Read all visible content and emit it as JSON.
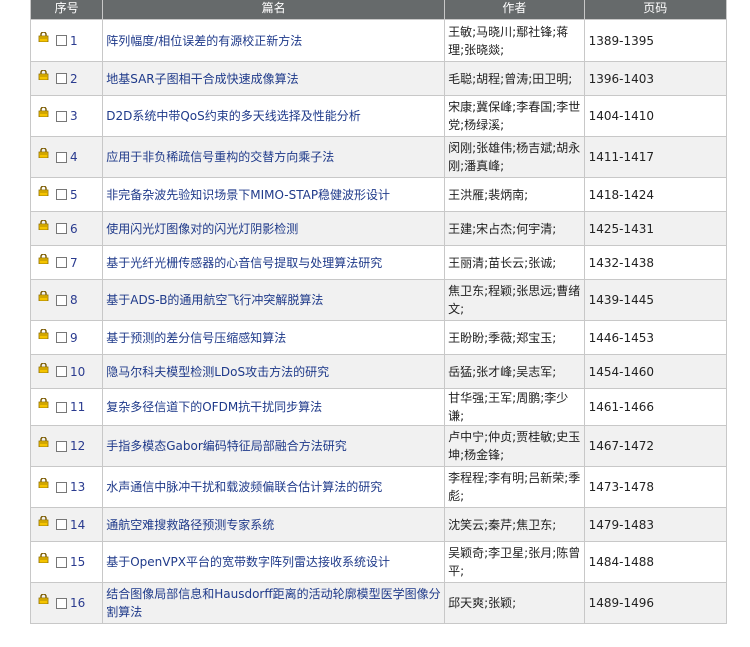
{
  "headers": {
    "seq": "序号",
    "title": "篇名",
    "author": "作者",
    "pages": "页码"
  },
  "rows": [
    {
      "num": "1",
      "title": "阵列幅度/相位误差的有源校正新方法",
      "authors": "王敏;马晓川;鄢社锋;蒋理;张晓燚;",
      "pages": "1389-1395"
    },
    {
      "num": "2",
      "title": "地基SAR子图相干合成快速成像算法",
      "authors": "毛聪;胡程;曾涛;田卫明;",
      "pages": "1396-1403"
    },
    {
      "num": "3",
      "title": "D2D系统中带QoS约束的多天线选择及性能分析",
      "authors": "宋康;冀保峰;李春国;李世党;杨绿溪;",
      "pages": "1404-1410"
    },
    {
      "num": "4",
      "title": "应用于非负稀疏信号重构的交替方向乘子法",
      "authors": "闵刚;张雄伟;杨吉斌;胡永刚;潘真峰;",
      "pages": "1411-1417"
    },
    {
      "num": "5",
      "title": "非完备杂波先验知识场景下MIMO-STAP稳健波形设计",
      "authors": "王洪雁;裴炳南;",
      "pages": "1418-1424"
    },
    {
      "num": "6",
      "title": "使用闪光灯图像对的闪光灯阴影检测",
      "authors": "王建;宋占杰;何宇清;",
      "pages": "1425-1431"
    },
    {
      "num": "7",
      "title": "基于光纤光栅传感器的心音信号提取与处理算法研究",
      "authors": "王丽清;苗长云;张诚;",
      "pages": "1432-1438"
    },
    {
      "num": "8",
      "title": "基于ADS-B的通用航空飞行冲突解脱算法",
      "authors": "焦卫东;程颖;张思远;曹绪文;",
      "pages": "1439-1445"
    },
    {
      "num": "9",
      "title": "基于预测的差分信号压缩感知算法",
      "authors": "王盼盼;季薇;郑宝玉;",
      "pages": "1446-1453"
    },
    {
      "num": "10",
      "title": "隐马尔科夫模型检测LDoS攻击方法的研究",
      "authors": "岳猛;张才峰;吴志军;",
      "pages": "1454-1460"
    },
    {
      "num": "11",
      "title": "复杂多径信道下的OFDM抗干扰同步算法",
      "authors": "甘华强;王军;周鹏;李少谦;",
      "pages": "1461-1466"
    },
    {
      "num": "12",
      "title": "手指多模态Gabor编码特征局部融合方法研究",
      "authors": "卢中宁;仲贞;贾桂敏;史玉坤;杨金锋;",
      "pages": "1467-1472"
    },
    {
      "num": "13",
      "title": "水声通信中脉冲干扰和载波频偏联合估计算法的研究",
      "authors": "李程程;李有明;吕新荣;季彪;",
      "pages": "1473-1478"
    },
    {
      "num": "14",
      "title": "通航空难搜救路径预测专家系统",
      "authors": "沈笑云;秦芹;焦卫东;",
      "pages": "1479-1483"
    },
    {
      "num": "15",
      "title": "基于OpenVPX平台的宽带数字阵列雷达接收系统设计",
      "authors": "吴颖奇;李卫星;张月;陈曾平;",
      "pages": "1484-1488"
    },
    {
      "num": "16",
      "title": "结合图像局部信息和Hausdorff距离的活动轮廓模型医学图像分割算法",
      "authors": "邱天爽;张颖;",
      "pages": "1489-1496"
    }
  ]
}
